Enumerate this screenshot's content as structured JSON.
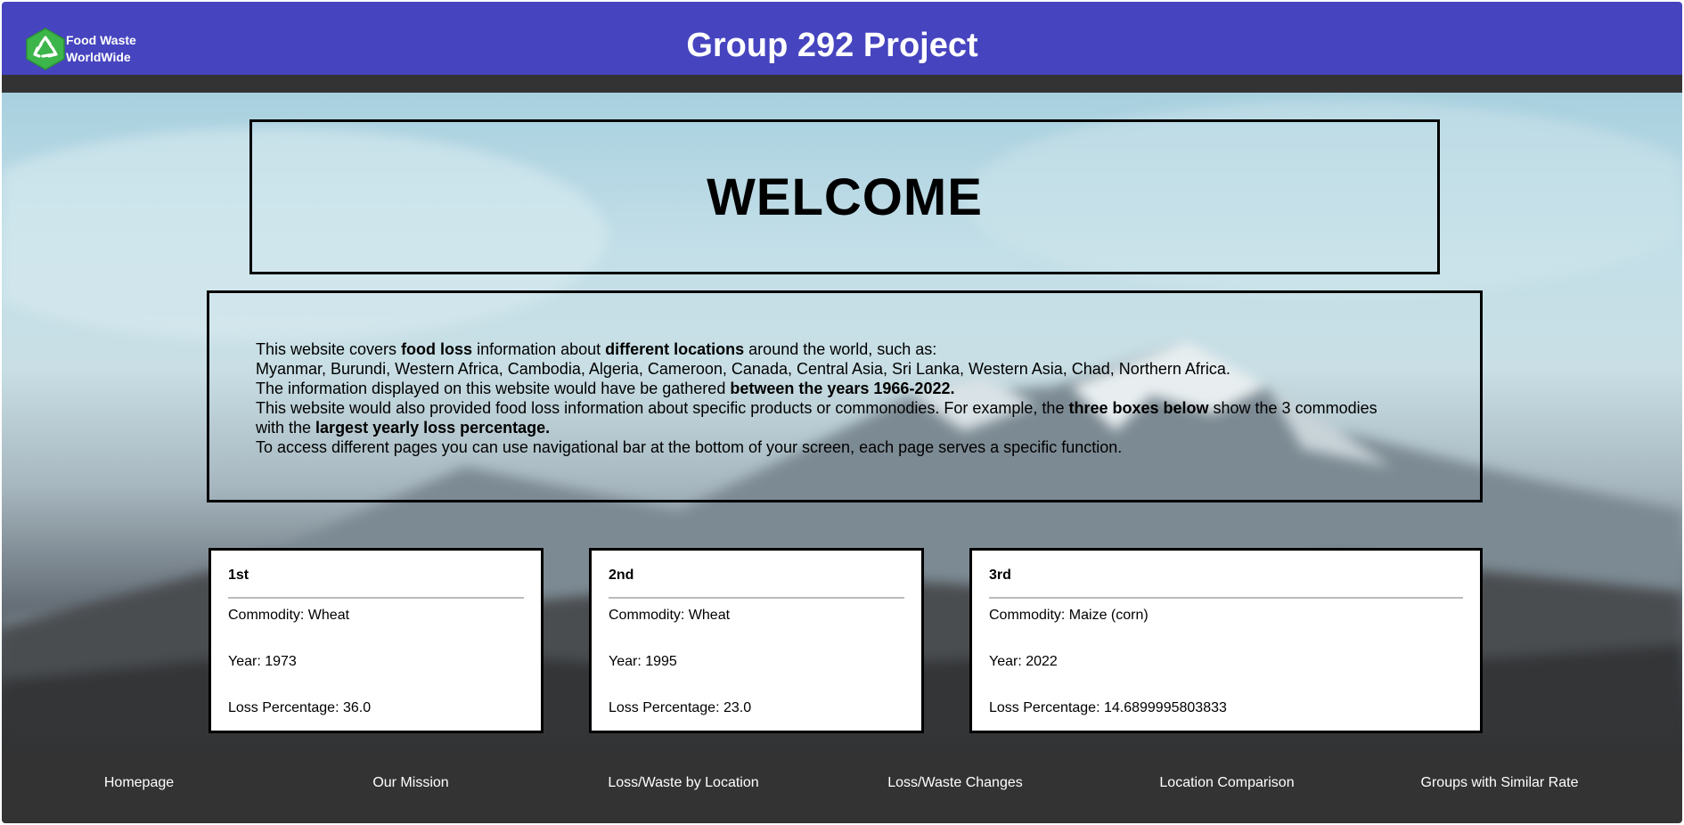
{
  "header": {
    "logo_line1": "Food Waste",
    "logo_line2": "WorldWide",
    "title": "Group 292 Project"
  },
  "welcome": {
    "heading": "WELCOME"
  },
  "info": {
    "l1_a": "This website covers ",
    "l1_b": "food loss",
    "l1_c": " information about ",
    "l1_d": "different locations",
    "l1_e": " around the world, such as:",
    "l2": "Myanmar, Burundi, Western Africa, Cambodia, Algeria, Cameroon, Canada, Central Asia, Sri Lanka, Western Asia, Chad, Northern Africa.",
    "l3_a": "The information displayed on this website would have be gathered ",
    "l3_b": "between the years 1966-2022.",
    "l4_a": "This website would also provided food loss information about specific products or commonodies. For example, the ",
    "l4_b": "three boxes below",
    "l4_c": " show the 3 commodies with the ",
    "l4_d": "largest yearly loss percentage.",
    "l5": "To access different pages you can use navigational bar at the bottom of your screen, each page serves a specific function."
  },
  "cards": [
    {
      "rank": "1st",
      "commodity": "Commodity: Wheat",
      "year": "Year: 1973",
      "loss": "Loss Percentage: 36.0"
    },
    {
      "rank": "2nd",
      "commodity": "Commodity: Wheat",
      "year": "Year: 1995",
      "loss": "Loss Percentage: 23.0"
    },
    {
      "rank": "3rd",
      "commodity": "Commodity: Maize (corn)",
      "year": "Year: 2022",
      "loss": "Loss Percentage: 14.6899995803833"
    }
  ],
  "nav": [
    "Homepage",
    "Our Mission",
    "Loss/Waste by Location",
    "Loss/Waste Changes",
    "Location Comparison",
    "Groups with Similar Rate"
  ],
  "colors": {
    "header_bg": "#4644bf",
    "bar_bg": "#333333",
    "logo_green": "#3cb54a"
  }
}
